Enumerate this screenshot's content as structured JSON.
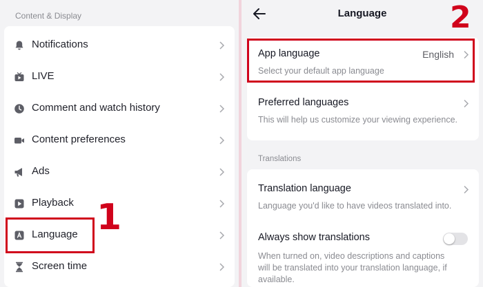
{
  "left": {
    "section_title": "Content & Display",
    "items": [
      {
        "label": "Notifications",
        "icon": "bell-icon"
      },
      {
        "label": "LIVE",
        "icon": "live-tv-icon"
      },
      {
        "label": "Comment and watch history",
        "icon": "clock-icon"
      },
      {
        "label": "Content preferences",
        "icon": "video-camera-icon"
      },
      {
        "label": "Ads",
        "icon": "megaphone-icon"
      },
      {
        "label": "Playback",
        "icon": "play-icon"
      },
      {
        "label": "Language",
        "icon": "language-icon"
      },
      {
        "label": "Screen time",
        "icon": "hourglass-icon"
      }
    ],
    "step_number": "1"
  },
  "right": {
    "title": "Language",
    "step_number": "2",
    "app_language": {
      "title": "App language",
      "value": "English",
      "subtitle": "Select your default app language"
    },
    "preferred_languages": {
      "title": "Preferred languages",
      "subtitle": "This will help us customize your viewing experience."
    },
    "translations_header": "Translations",
    "translation_language": {
      "title": "Translation language",
      "subtitle": "Language you'd like to have videos translated into."
    },
    "always_show": {
      "title": "Always show translations",
      "subtitle_line1": "When turned on, video descriptions and captions",
      "subtitle_line2": "will be translated into your translation language, if",
      "subtitle_line3": "available.",
      "enabled": false
    }
  },
  "colors": {
    "highlight_red": "#d0021b",
    "background": "#f3f3f5",
    "divider_pink": "#f1d4dc"
  }
}
